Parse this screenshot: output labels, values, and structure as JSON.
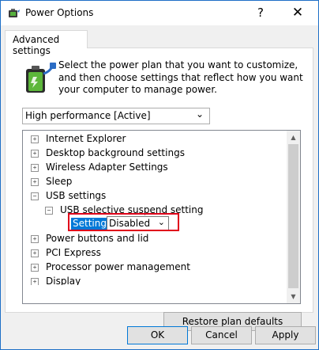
{
  "window": {
    "title": "Power Options",
    "help_glyph": "?",
    "close_glyph": "✕"
  },
  "tab": {
    "label": "Advanced settings"
  },
  "description": "Select the power plan that you want to customize, and then choose settings that reflect how you want your computer to manage power.",
  "plan_select": {
    "value": "High performance [Active]"
  },
  "tree": {
    "items": [
      {
        "label": "Internet Explorer",
        "expander": "+"
      },
      {
        "label": "Desktop background settings",
        "expander": "+"
      },
      {
        "label": "Wireless Adapter Settings",
        "expander": "+"
      },
      {
        "label": "Sleep",
        "expander": "+"
      },
      {
        "label": "USB settings",
        "expander": "−"
      },
      {
        "label": "USB selective suspend setting",
        "expander": "−"
      },
      {
        "label": "Power buttons and lid",
        "expander": "+"
      },
      {
        "label": "PCI Express",
        "expander": "+"
      },
      {
        "label": "Processor power management",
        "expander": "+"
      },
      {
        "label": "Display",
        "expander": "+"
      }
    ],
    "setting": {
      "label": "Setting:",
      "value": "Disabled"
    }
  },
  "buttons": {
    "restore": "Restore plan defaults",
    "ok": "OK",
    "cancel": "Cancel",
    "apply": "Apply"
  },
  "glyphs": {
    "dropdown": "⌄",
    "scroll_up": "▲",
    "scroll_down": "▼"
  },
  "colors": {
    "accent": "#0078d7",
    "highlight_box": "#e0001b"
  }
}
